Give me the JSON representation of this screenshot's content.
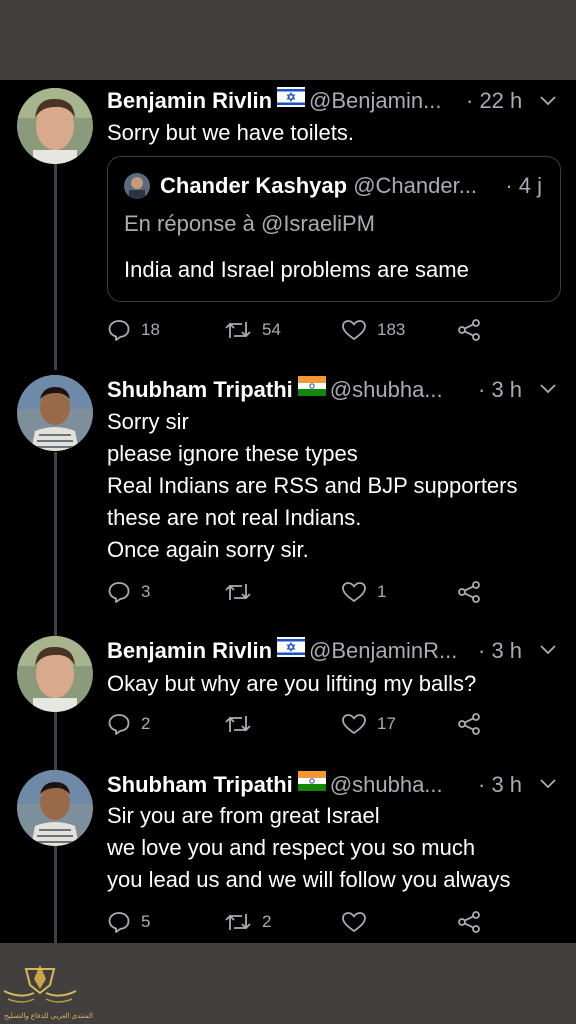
{
  "colors": {
    "background": "#000000",
    "bar": "#433f3f",
    "muted": "#a7adb2",
    "thread_line": "#3d4247"
  },
  "tweets": [
    {
      "name": "Benjamin Rivlin",
      "flag": "israel-flag",
      "handle": "@Benjamin...",
      "time": "· 22 h",
      "lines": [
        "Sorry but we have toilets."
      ],
      "quote": {
        "name": "Chander Kashyap",
        "handle": "@Chander...",
        "time": "· 4 j",
        "reply_to": "En réponse à @IsraeliPM",
        "text": "India and Israel problems are same"
      },
      "replies": "18",
      "retweets": "54",
      "likes": "183"
    },
    {
      "name": "Shubham Tripathi",
      "flag": "india-flag",
      "handle": "@shubha...",
      "time": "· 3 h",
      "lines": [
        "Sorry sir",
        "please ignore these types",
        "Real Indians are RSS and BJP supporters",
        "these are not real Indians.",
        "Once again sorry sir."
      ],
      "replies": "3",
      "retweets": "",
      "likes": "1"
    },
    {
      "name": "Benjamin Rivlin",
      "flag": "israel-flag",
      "handle": "@BenjaminR...",
      "time": "· 3 h",
      "lines": [
        "Okay but why are you lifting my balls?"
      ],
      "replies": "2",
      "retweets": "",
      "likes": "17"
    },
    {
      "name": "Shubham Tripathi",
      "flag": "india-flag",
      "handle": "@shubha...",
      "time": "· 3 h",
      "lines": [
        "Sir you are from great Israel",
        "we love you and respect you so much",
        "you lead us and we will follow you always"
      ],
      "replies": "5",
      "retweets": "2",
      "likes": ""
    }
  ],
  "watermark": {
    "text": "المنتدى العربي للدفاع والتسليح"
  }
}
